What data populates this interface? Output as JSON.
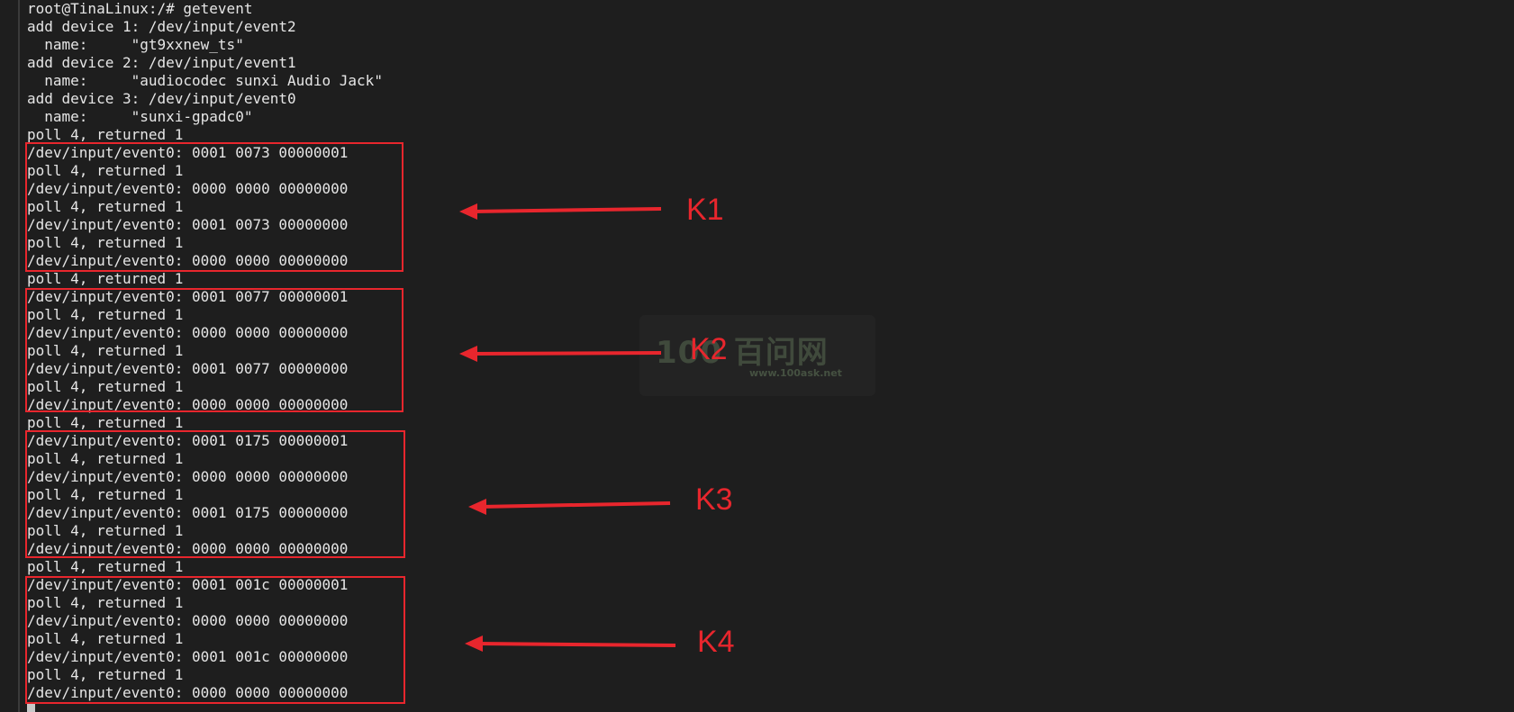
{
  "terminal": {
    "lines": [
      "root@TinaLinux:/# getevent",
      "add device 1: /dev/input/event2",
      "  name:     \"gt9xxnew_ts\"",
      "add device 2: /dev/input/event1",
      "  name:     \"audiocodec sunxi Audio Jack\"",
      "add device 3: /dev/input/event0",
      "  name:     \"sunxi-gpadc0\"",
      "poll 4, returned 1",
      "/dev/input/event0: 0001 0073 00000001",
      "poll 4, returned 1",
      "/dev/input/event0: 0000 0000 00000000",
      "poll 4, returned 1",
      "/dev/input/event0: 0001 0073 00000000",
      "poll 4, returned 1",
      "/dev/input/event0: 0000 0000 00000000",
      "poll 4, returned 1",
      "/dev/input/event0: 0001 0077 00000001",
      "poll 4, returned 1",
      "/dev/input/event0: 0000 0000 00000000",
      "poll 4, returned 1",
      "/dev/input/event0: 0001 0077 00000000",
      "poll 4, returned 1",
      "/dev/input/event0: 0000 0000 00000000",
      "poll 4, returned 1",
      "/dev/input/event0: 0001 0175 00000001",
      "poll 4, returned 1",
      "/dev/input/event0: 0000 0000 00000000",
      "poll 4, returned 1",
      "/dev/input/event0: 0001 0175 00000000",
      "poll 4, returned 1",
      "/dev/input/event0: 0000 0000 00000000",
      "poll 4, returned 1",
      "/dev/input/event0: 0001 001c 00000001",
      "poll 4, returned 1",
      "/dev/input/event0: 0000 0000 00000000",
      "poll 4, returned 1",
      "/dev/input/event0: 0001 001c 00000000",
      "poll 4, returned 1",
      "/dev/input/event0: 0000 0000 00000000"
    ]
  },
  "annotations": {
    "k1": "K1",
    "k2": "K2",
    "k3": "K3",
    "k4": "K4",
    "color": "#e8262d"
  },
  "watermark": {
    "logo": "100 百问网",
    "url": "www.100ask.net"
  }
}
